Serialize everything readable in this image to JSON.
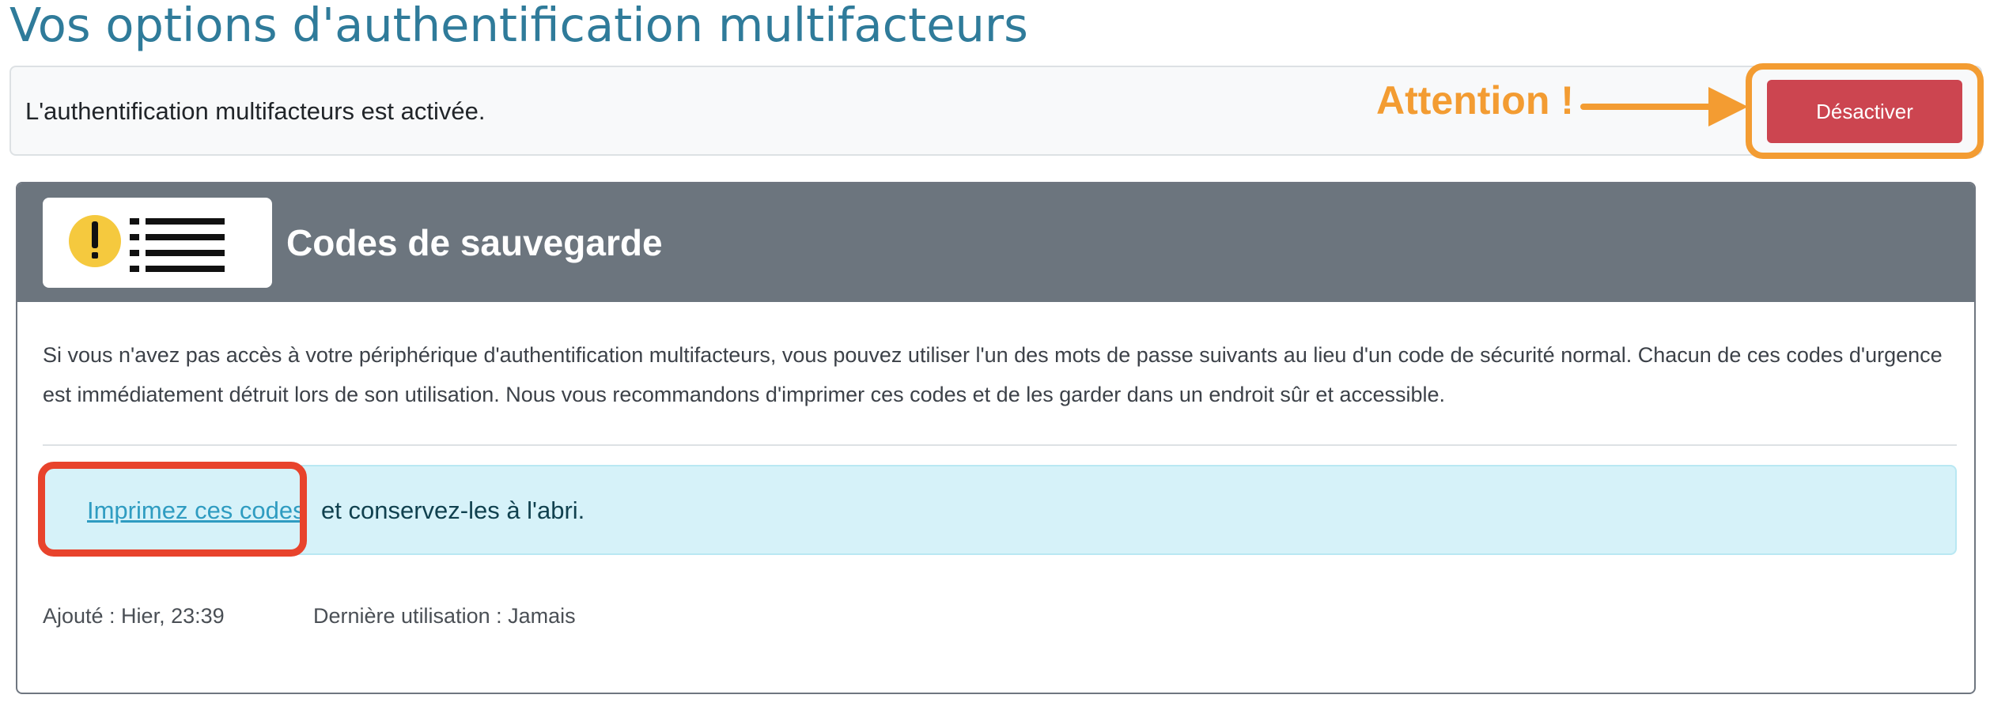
{
  "page": {
    "title": "Vos options d'authentification multifacteurs"
  },
  "status": {
    "text": "L'authentification multifacteurs est activée.",
    "disable_label": "Désactiver"
  },
  "annotation": {
    "attention": "Attention !",
    "accent_color": "#f39c32",
    "arrow_color": "#e8432c"
  },
  "card": {
    "title": "Codes de sauvegarde",
    "description": "Si vous n'avez pas accès à votre périphérique d'authentification multifacteurs, vous pouvez utiliser l'un des mots de passe suivants au lieu d'un code de sécurité normal. Chacun de ces codes d'urgence est immédiatement détruit lors de son utilisation. Nous vous recommandons d'imprimer ces codes et de les garder dans un endroit sûr et accessible.",
    "print_link": "Imprimez ces codes",
    "print_suffix": " et conservez-les à l'abri.",
    "added": "Ajouté : Hier, 23:39",
    "last_used": "Dernière utilisation : Jamais",
    "icons": [
      "warning-icon",
      "list-icon"
    ]
  },
  "colors": {
    "title": "#2f7b9a",
    "danger": "#cc4550",
    "card_header": "#6c757e",
    "info_bg": "#d6f2f9",
    "link": "#2f9cc1"
  }
}
